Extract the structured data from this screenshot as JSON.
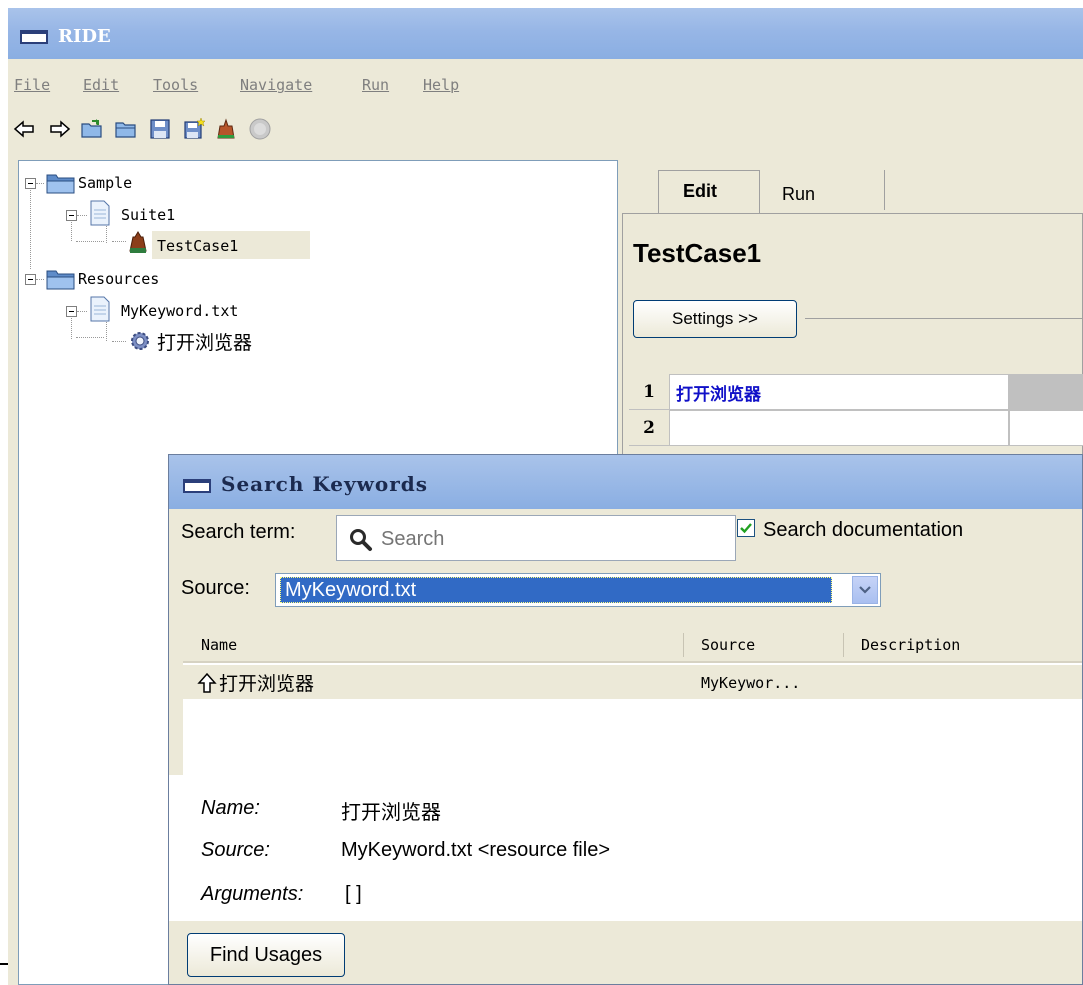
{
  "window": {
    "title": "RIDE"
  },
  "menu": [
    "File",
    "Edit",
    "Tools",
    "Navigate",
    "Run",
    "Help"
  ],
  "toolbar": {
    "icons": [
      "back-arrow-icon",
      "forward-arrow-icon",
      "open-suite-icon",
      "open-directory-icon",
      "save-icon",
      "save-all-icon",
      "run-icon",
      "stop-icon"
    ]
  },
  "tree": {
    "items": [
      {
        "label": "Sample",
        "icon": "folder-icon"
      },
      {
        "label": "Suite1",
        "icon": "file-icon"
      },
      {
        "label": "TestCase1",
        "icon": "testcase-icon"
      },
      {
        "label": "Resources",
        "icon": "folder-icon"
      },
      {
        "label": "MyKeyword.txt",
        "icon": "file-icon"
      },
      {
        "label": "打开浏览器",
        "icon": "keyword-gear-icon"
      }
    ]
  },
  "editor": {
    "tabs": [
      "Edit",
      "Run"
    ],
    "active_tab": "Edit",
    "testcase_title": "TestCase1",
    "settings_button": "Settings >>",
    "rows": [
      {
        "num": "1",
        "value": "打开浏览器"
      },
      {
        "num": "2",
        "value": ""
      }
    ]
  },
  "dialog": {
    "title": "Search Keywords",
    "search_label": "Search term:",
    "search_placeholder": "Search",
    "search_doc_label": "Search documentation",
    "search_doc_checked": true,
    "source_label": "Source:",
    "source_value": "MyKeyword.txt",
    "columns": [
      "Name",
      "Source",
      "Description"
    ],
    "results": [
      {
        "name": "打开浏览器",
        "source": "MyKeywor...",
        "description": ""
      }
    ],
    "details": {
      "name_label": "Name:",
      "name_value": "打开浏览器",
      "source_label": "Source:",
      "source_value": "MyKeyword.txt <resource file>",
      "args_label": "Arguments:",
      "args_value": "[ ]"
    },
    "find_usages_button": "Find Usages"
  },
  "colors": {
    "titlebar": "#97b6e6",
    "selection": "#316ac5",
    "keyword_text": "#1010c8",
    "panel_bg": "#ece9d8"
  }
}
